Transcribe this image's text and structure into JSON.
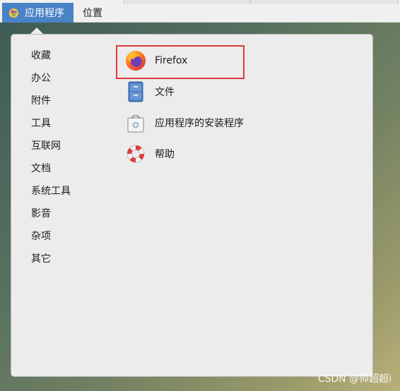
{
  "topbar": {
    "applications_label": "应用程序",
    "places_label": "位置"
  },
  "menu": {
    "categories": [
      {
        "label": "收藏"
      },
      {
        "label": "办公"
      },
      {
        "label": "附件"
      },
      {
        "label": "工具"
      },
      {
        "label": "互联网"
      },
      {
        "label": "文档"
      },
      {
        "label": "系统工具"
      },
      {
        "label": "影音"
      },
      {
        "label": "杂项"
      },
      {
        "label": "其它"
      }
    ],
    "apps": [
      {
        "label": "Firefox",
        "icon": "firefox-icon",
        "highlighted": true
      },
      {
        "label": "文件",
        "icon": "file-cabinet-icon"
      },
      {
        "label": "应用程序的安装程序",
        "icon": "software-bag-icon"
      },
      {
        "label": "帮助",
        "icon": "lifebuoy-icon"
      }
    ]
  },
  "watermark": "CSDN @帅超超i",
  "colors": {
    "accent": "#4a82c6",
    "highlight_border": "#e0383a",
    "menu_bg": "#ececec"
  }
}
